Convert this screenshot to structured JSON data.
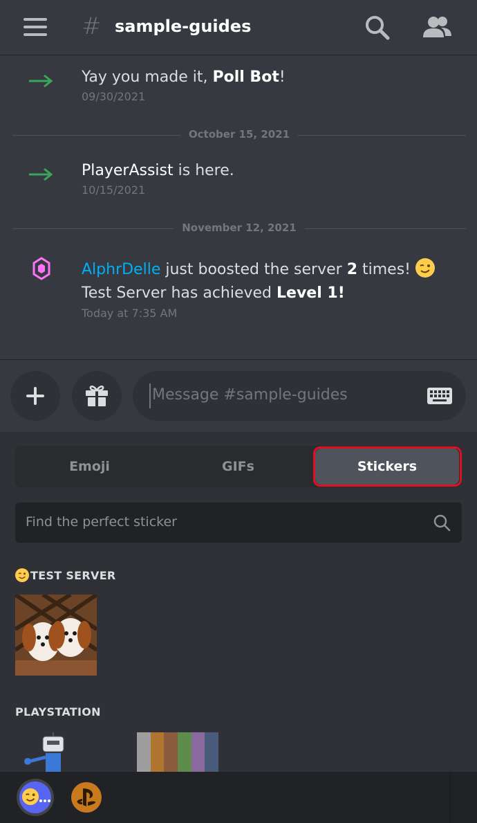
{
  "header": {
    "hash": "#",
    "channel": "sample-guides",
    "icons": [
      "menu-icon",
      "search-icon",
      "members-icon"
    ]
  },
  "messages": [
    {
      "type": "join",
      "prefix": "Yay you made it, ",
      "name": "Poll Bot",
      "suffix": "!",
      "time": "09/30/2021"
    },
    {
      "type": "divider",
      "label": "October 15, 2021"
    },
    {
      "type": "join",
      "name": "PlayerAssist",
      "suffix": " is here.",
      "time": "10/15/2021"
    },
    {
      "type": "divider",
      "label": "November 12, 2021"
    },
    {
      "type": "boost",
      "user": "AlphrDelle",
      "text1": " just boosted the server ",
      "count": "2",
      "text2": " times! ",
      "text3": " Test Server has achieved ",
      "level": "Level 1!",
      "time": "Today at 7:35 AM"
    }
  ],
  "composer": {
    "placeholder": "Message #sample-guides"
  },
  "picker": {
    "tabs": {
      "emoji": "Emoji",
      "gifs": "GIFs",
      "stickers": "Stickers"
    },
    "active_tab": "Stickers",
    "search_placeholder": "Find the perfect sticker",
    "sections": {
      "test_server": "TEST SERVER",
      "playstation": "PLAYSTATION"
    }
  },
  "colors": {
    "background": "#36393f",
    "panel": "#2f3136",
    "accent_blue": "#00aff4",
    "join_green": "#3ba55c",
    "boost_pink": "#ff73fa",
    "highlight_red": "#e01020"
  }
}
